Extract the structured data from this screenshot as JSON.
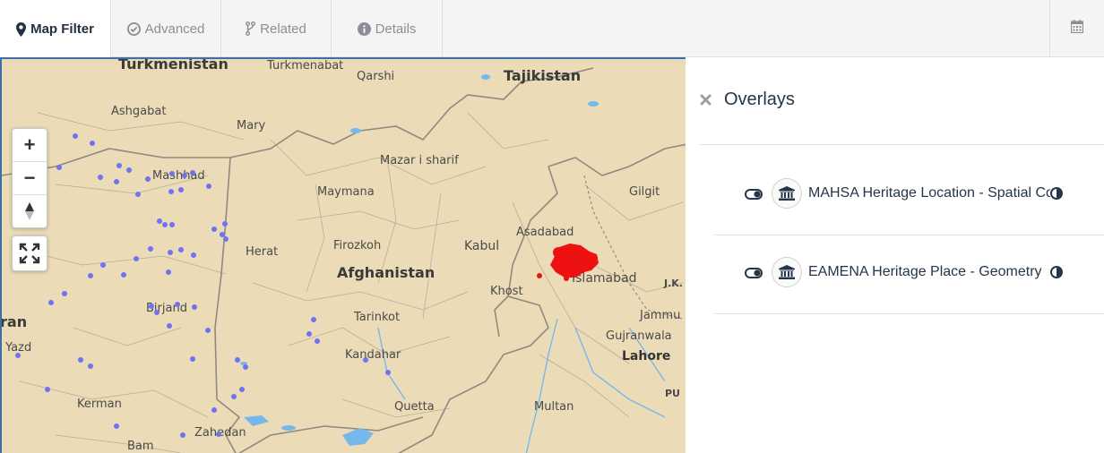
{
  "tabs": [
    {
      "label": "Map Filter",
      "icon": "map-marker-icon",
      "active": true
    },
    {
      "label": "Advanced",
      "icon": "check-circle-icon",
      "active": false
    },
    {
      "label": "Related",
      "icon": "code-fork-icon",
      "active": false
    },
    {
      "label": "Details",
      "icon": "info-circle-icon",
      "active": false
    }
  ],
  "toolbar": {
    "calendar_icon": "calendar-icon"
  },
  "map": {
    "controls": {
      "zoom_in": "+",
      "zoom_out": "−",
      "compass": "▲",
      "fullscreen_icon": "expand-icon"
    },
    "labels": {
      "turkmenistan": "Turkmenistan",
      "turkmenabat": "Turkmenabat",
      "qarshi": "Qarshi",
      "tajikistan": "Tajikistan",
      "ashgabat": "Ashgabat",
      "mary": "Mary",
      "mashhad": "Mashhad",
      "mazar": "Mazar i sharif",
      "maymana": "Maymana",
      "gilgit": "Gilgit",
      "asadabad": "Asadabad",
      "herat": "Herat",
      "firozkoh": "Firozkoh",
      "kabul": "Kabul",
      "afghanistan": "Afghanistan",
      "khost": "Khost",
      "islamabad": "Islamabad",
      "jk": "J.K.",
      "iran": "ran",
      "birjand": "Birjand",
      "tarinkot": "Tarinkot",
      "jammu": "Jammu",
      "yazd": "Yazd",
      "gujranwala": "Gujranwala",
      "kandahar": "Kandahar",
      "lahore": "Lahore",
      "kerman": "Kerman",
      "pu": "PU",
      "quetta": "Quetta",
      "multan": "Multan",
      "zahedan": "Zahedan",
      "bam": "Bam"
    },
    "colors": {
      "land": "#ebdcb7",
      "border": "#8f8a7e",
      "water": "#74b8ec",
      "points": "#6f72f2",
      "highlight": "#ee1111"
    }
  },
  "panel": {
    "title": "Overlays",
    "close_icon": "close-icon",
    "overlays": [
      {
        "label": "MAHSA Heritage Location - Spatial Coordinates",
        "icon": "institution-icon",
        "toggle_icon": "toggle-icon",
        "opacity_icon": "adjust-icon"
      },
      {
        "label": "EAMENA Heritage Place - Geometry",
        "icon": "institution-icon",
        "toggle_icon": "toggle-icon",
        "opacity_icon": "adjust-icon"
      }
    ]
  }
}
